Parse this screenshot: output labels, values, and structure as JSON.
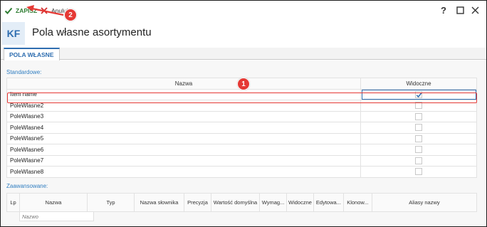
{
  "toolbar": {
    "save_label": "ZAPISZ",
    "cancel_label": "Anuluj",
    "help_glyph": "?",
    "icons": {
      "save": "check-icon",
      "cancel": "x-icon",
      "help": "help-icon",
      "maximize": "maximize-icon",
      "close": "close-icon"
    },
    "colors": {
      "save": "#2e7d32",
      "cancel": "#d32f2f"
    }
  },
  "header": {
    "badge": "KF",
    "title": "Pola własne asortymentu"
  },
  "tabs": [
    {
      "label": "POLA WŁASNE",
      "active": true
    }
  ],
  "standard": {
    "section_label": "Standardowe:",
    "columns": [
      "Nazwa",
      "Widoczne"
    ],
    "rows": [
      {
        "name": "Item name",
        "visible": true
      },
      {
        "name": "PoleWlasne2",
        "visible": false
      },
      {
        "name": "PoleWlasne3",
        "visible": false
      },
      {
        "name": "PoleWlasne4",
        "visible": false
      },
      {
        "name": "PoleWlasne5",
        "visible": false
      },
      {
        "name": "PoleWlasne6",
        "visible": false
      },
      {
        "name": "PoleWlasne7",
        "visible": false
      },
      {
        "name": "PoleWlasne8",
        "visible": false
      }
    ]
  },
  "advanced": {
    "section_label": "Zaawansowane:",
    "columns": [
      "Lp",
      "Nazwa",
      "Typ",
      "Nazwa słownika",
      "Precyzja",
      "Wartość domyślna",
      "Wymag...",
      "Widoczne",
      "Edytowa...",
      "Klonow...",
      "Aliasy nazwy"
    ],
    "filter_placeholder": "Nazwo"
  },
  "annotations": {
    "marker_1": "1",
    "marker_2": "2",
    "color": "#e53935"
  }
}
